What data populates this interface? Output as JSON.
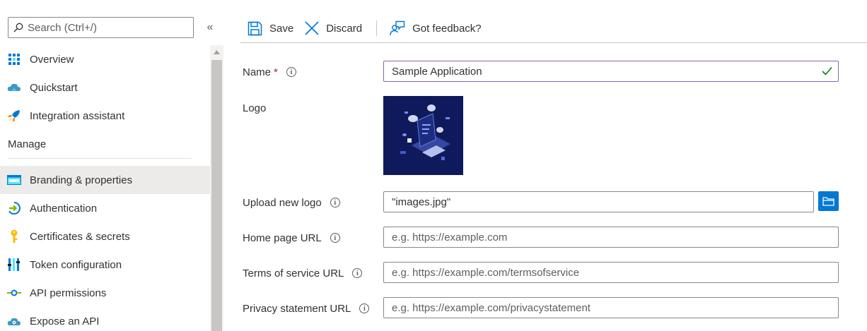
{
  "sidebar": {
    "search_placeholder": "Search (Ctrl+/)",
    "collapse_label": "«",
    "items_top": [
      {
        "label": "Overview",
        "icon": "overview-grid-icon"
      },
      {
        "label": "Quickstart",
        "icon": "cloud-icon"
      },
      {
        "label": "Integration assistant",
        "icon": "rocket-icon"
      }
    ],
    "section_title": "Manage",
    "items_manage": [
      {
        "label": "Branding & properties",
        "icon": "branding-icon",
        "active": true
      },
      {
        "label": "Authentication",
        "icon": "authentication-icon"
      },
      {
        "label": "Certificates & secrets",
        "icon": "key-icon"
      },
      {
        "label": "Token configuration",
        "icon": "token-bars-icon"
      },
      {
        "label": "API permissions",
        "icon": "api-permissions-icon"
      },
      {
        "label": "Expose an API",
        "icon": "cloud-gear-icon"
      }
    ]
  },
  "toolbar": {
    "save_label": "Save",
    "discard_label": "Discard",
    "feedback_label": "Got feedback?"
  },
  "form": {
    "name_label": "Name",
    "required_mark": "*",
    "name_value": "Sample Application",
    "logo_label": "Logo",
    "upload_label": "Upload new logo",
    "upload_value": "\"images.jpg\"",
    "homepage_label": "Home page URL",
    "homepage_placeholder": "e.g. https://example.com",
    "terms_label": "Terms of service URL",
    "terms_placeholder": "e.g. https://example.com/termsofservice",
    "privacy_label": "Privacy statement URL",
    "privacy_placeholder": "e.g. https://example.com/privacystatement",
    "info_glyph": "i"
  },
  "colors": {
    "accent": "#0078d4",
    "name_border": "#8764b8",
    "valid_check": "#107c10",
    "required": "#a4262c",
    "active_bg": "#edebe9"
  }
}
